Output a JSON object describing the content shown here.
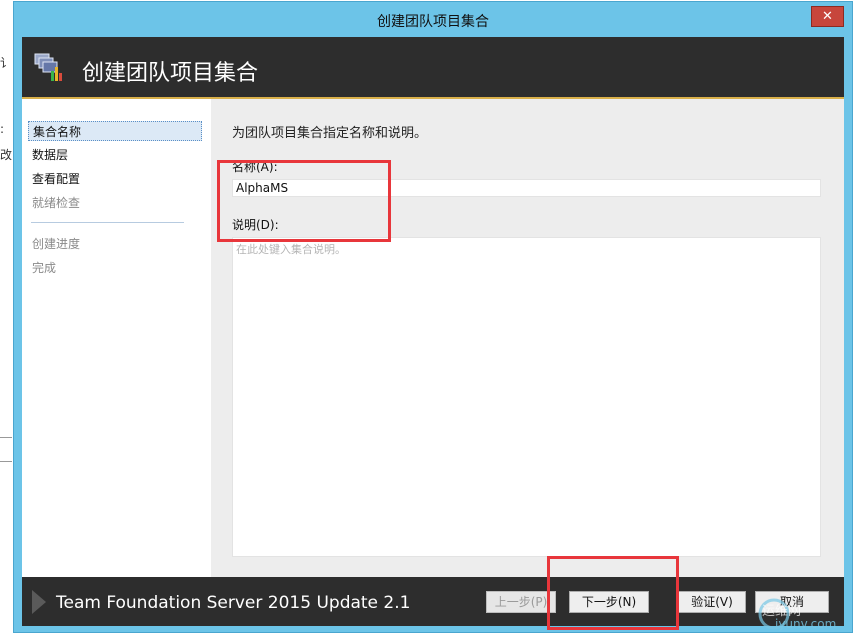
{
  "window": {
    "title": "创建团队项目集合"
  },
  "header": {
    "title": "创建团队项目集合"
  },
  "nav": {
    "items": [
      {
        "label": "集合名称",
        "state": "active"
      },
      {
        "label": "数据层",
        "state": "enabled"
      },
      {
        "label": "查看配置",
        "state": "enabled"
      },
      {
        "label": "就绪检查",
        "state": "disabled"
      },
      {
        "label": "创建进度",
        "state": "disabled"
      },
      {
        "label": "完成",
        "state": "disabled"
      }
    ]
  },
  "main": {
    "intro": "为团队项目集合指定名称和说明。",
    "name_label": "名称(A):",
    "name_value": "AlphaMS",
    "description_label": "说明(D):",
    "description_placeholder": "在此处键入集合说明。"
  },
  "footer": {
    "product": "Team Foundation Server 2015 Update 2.1",
    "buttons": {
      "previous": "上一步(P)",
      "next": "下一步(N)",
      "verify": "验证(V)",
      "cancel": "取消"
    }
  },
  "watermark": {
    "line1": "运维网",
    "line2": "iyunv.com"
  },
  "colors": {
    "titlebar": "#6cc4e8",
    "header_bg": "#2d2d2d",
    "header_border": "#d9b04a",
    "highlight": "#e8363b",
    "close": "#c7463c"
  }
}
